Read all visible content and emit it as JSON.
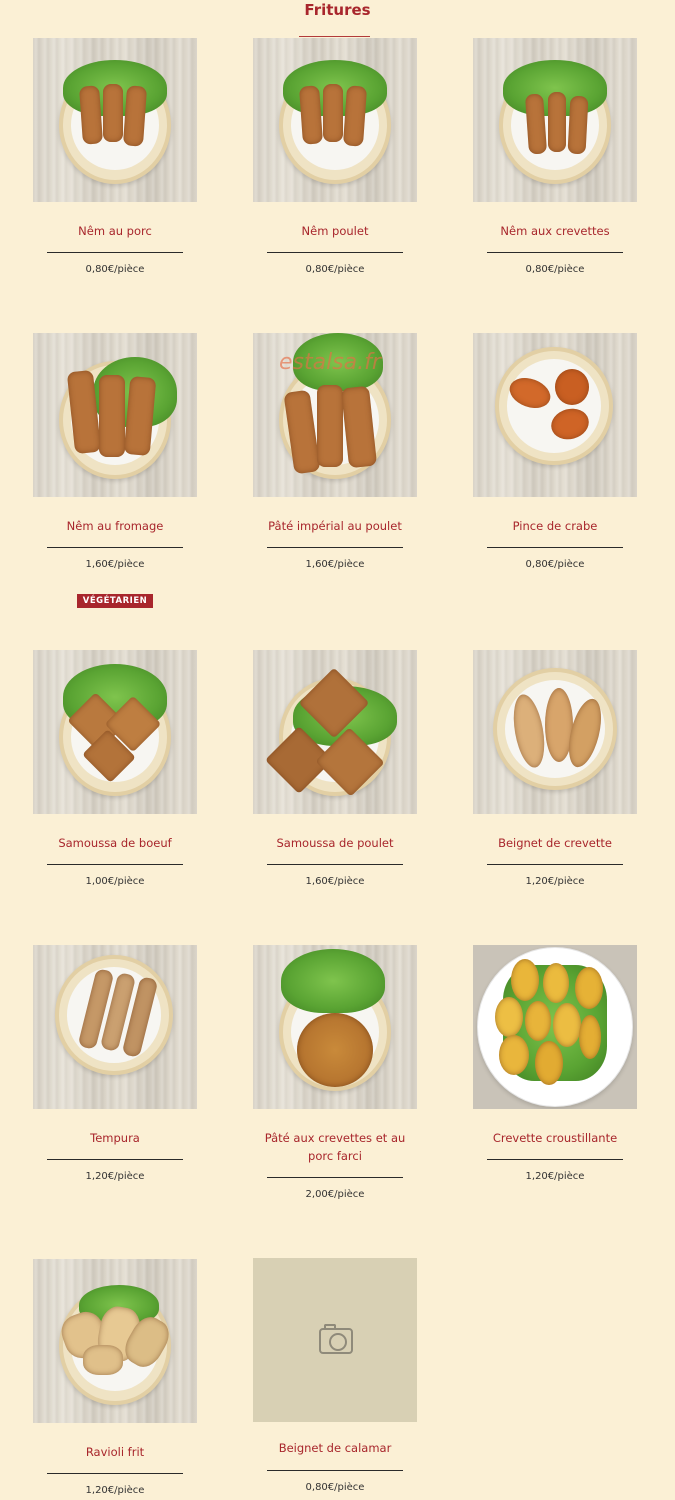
{
  "section": {
    "title": "Fritures"
  },
  "badge": "VÉGÉTARIEN",
  "watermark": "estalsa.fr",
  "items": [
    {
      "name": "Nêm au porc",
      "price": "0,80€/pièce"
    },
    {
      "name": "Nêm poulet",
      "price": "0,80€/pièce"
    },
    {
      "name": "Nêm aux crevettes",
      "price": "0,80€/pièce"
    },
    {
      "name": "Nêm au fromage",
      "price": "1,60€/pièce"
    },
    {
      "name": "Pâté impérial au poulet",
      "price": "1,60€/pièce"
    },
    {
      "name": "Pince de crabe",
      "price": "0,80€/pièce"
    },
    {
      "name": "Samoussa de boeuf",
      "price": "1,00€/pièce"
    },
    {
      "name": "Samoussa de poulet",
      "price": "1,60€/pièce"
    },
    {
      "name": "Beignet de crevette",
      "price": "1,20€/pièce"
    },
    {
      "name": "Tempura",
      "price": "1,20€/pièce"
    },
    {
      "name": "Pâté aux crevettes et au porc farci",
      "price": "2,00€/pièce"
    },
    {
      "name": "Crevette croustillante",
      "price": "1,20€/pièce"
    },
    {
      "name": "Ravioli frit",
      "price": "1,20€/pièce"
    },
    {
      "name": "Beignet de calamar",
      "price": "0,80€/pièce",
      "placeholder_icon": "camera-icon"
    }
  ]
}
